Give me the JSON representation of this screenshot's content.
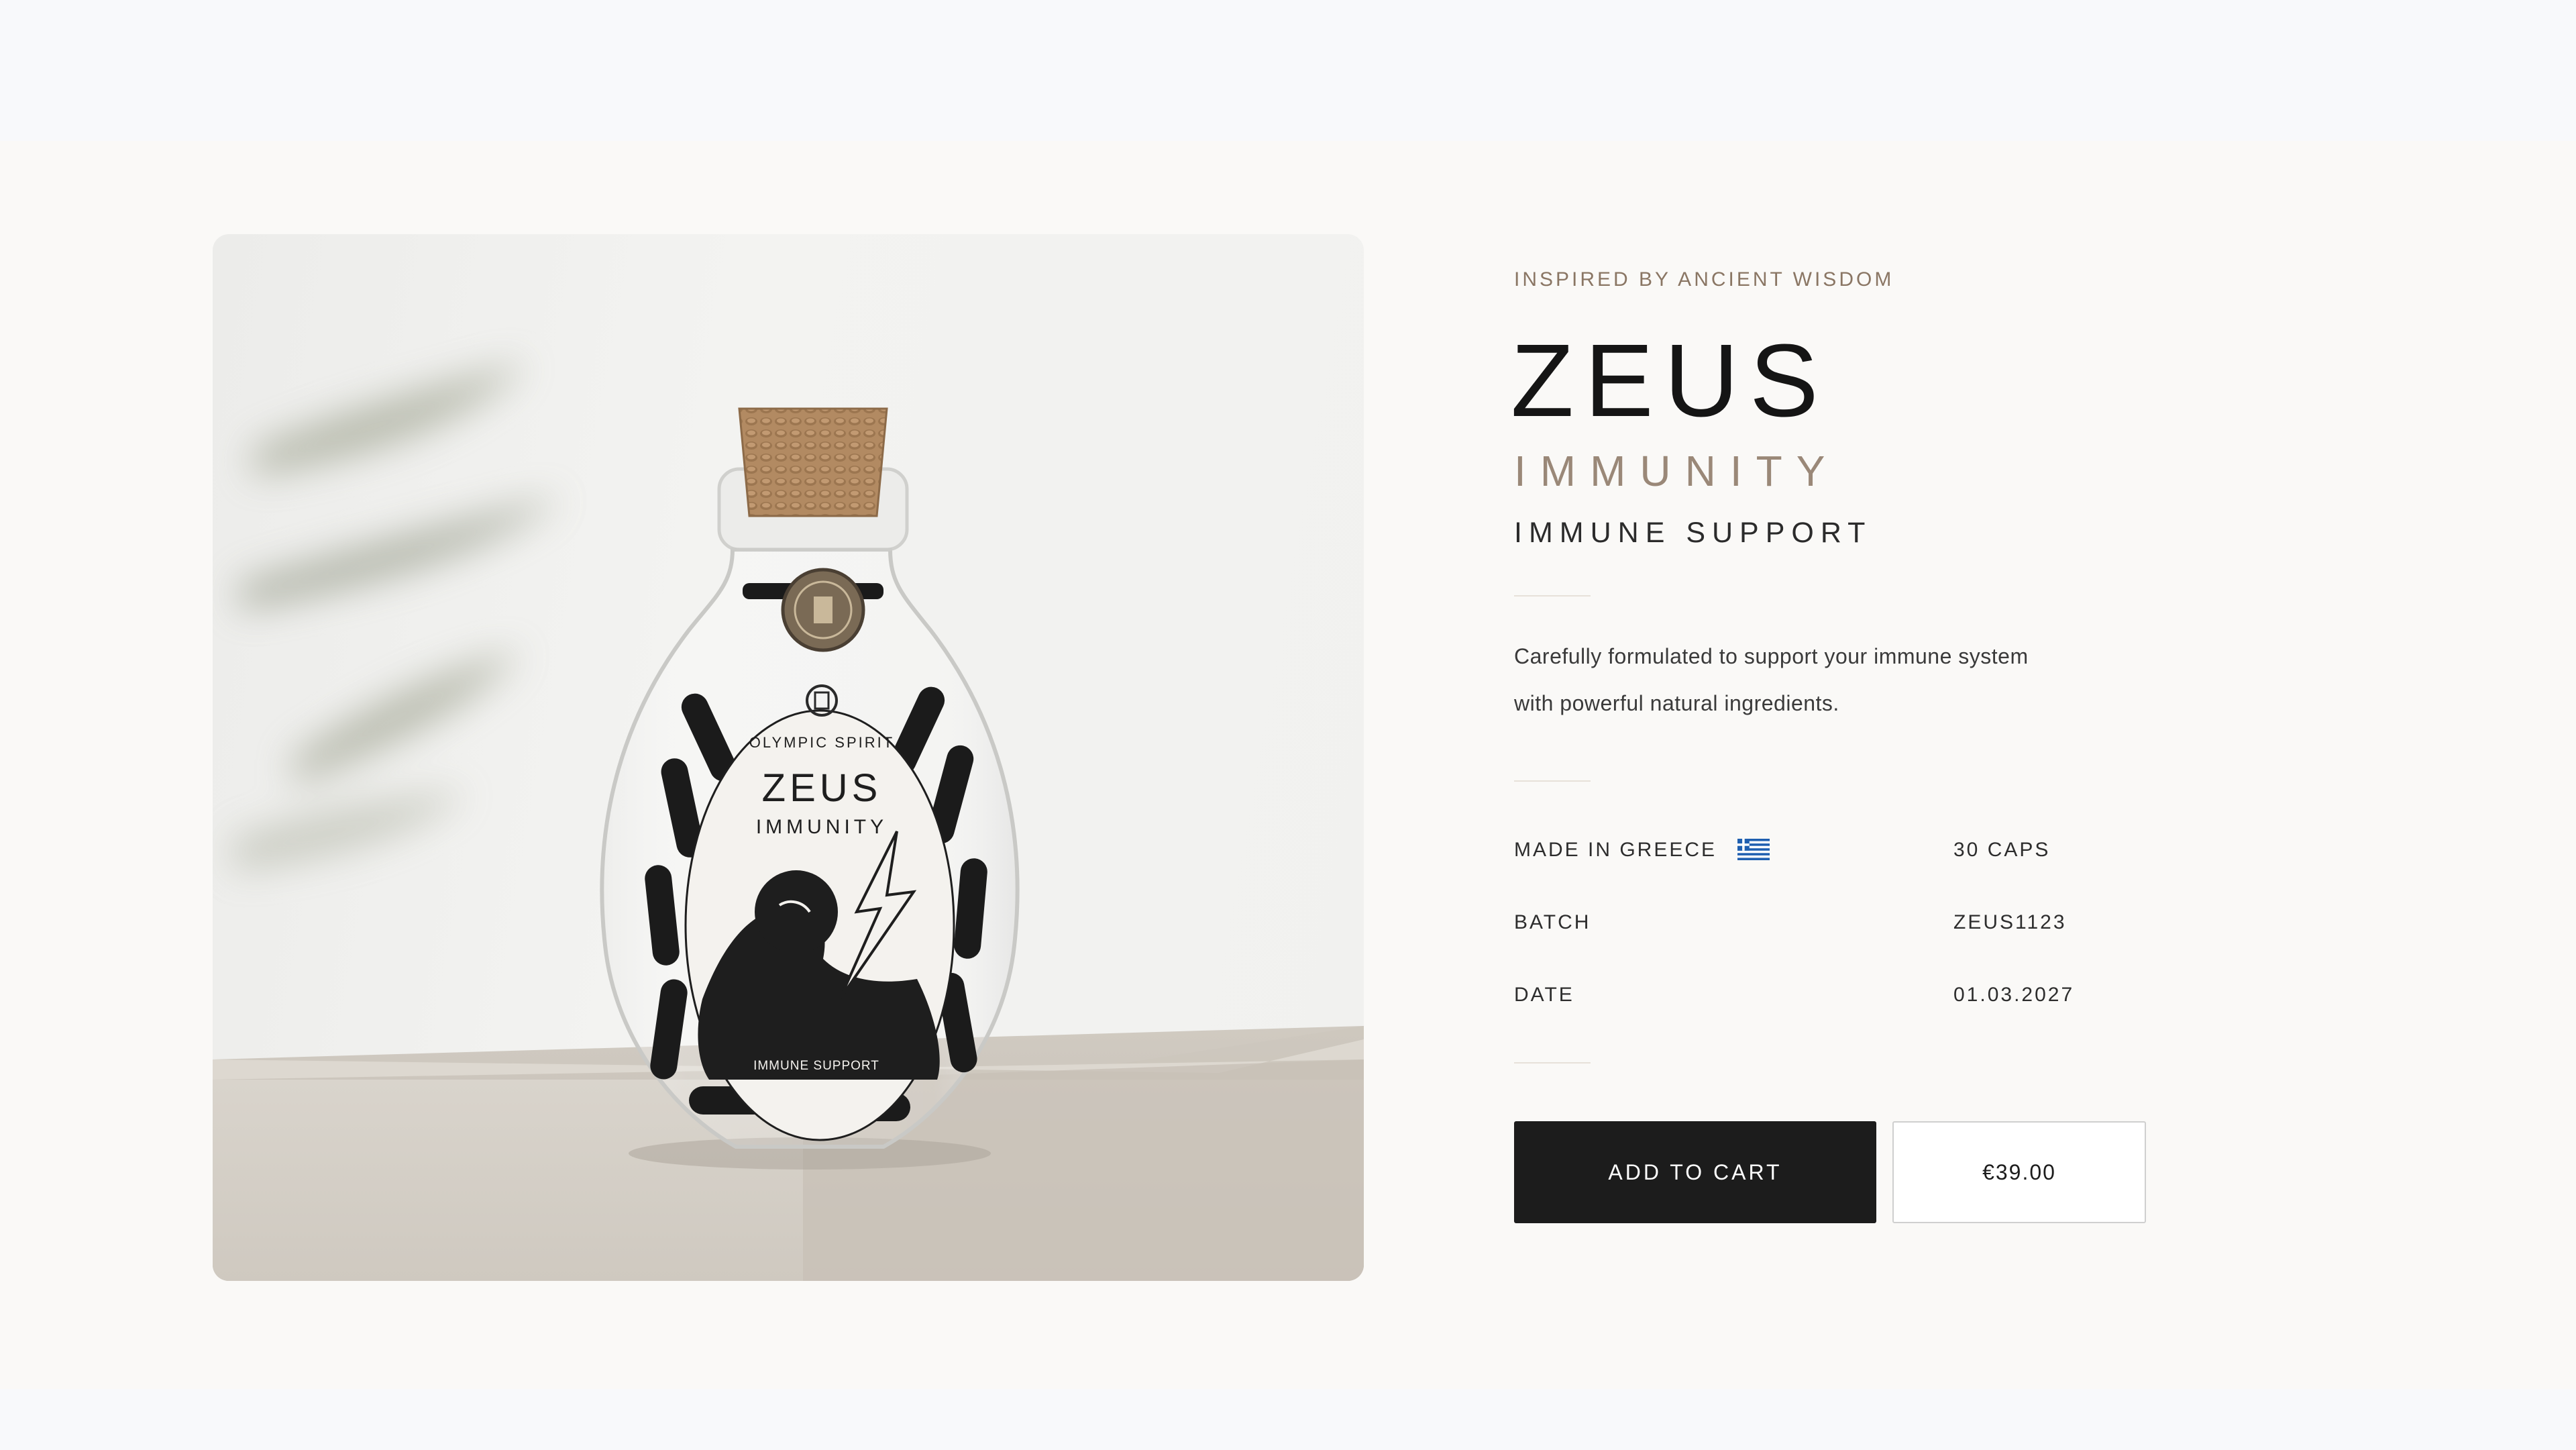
{
  "product": {
    "eyebrow": "INSPIRED BY ANCIENT WISDOM",
    "title": "ZEUS",
    "subtitle": "IMMUNITY",
    "tagline": "IMMUNE SUPPORT",
    "description_lines": [
      "Carefully formulated to support your immune system",
      "with powerful natural ingredients."
    ]
  },
  "specs": [
    {
      "label": "MADE IN GREECE",
      "value": "30 CAPS"
    },
    {
      "label": "BATCH",
      "value": "ZEUS1123"
    },
    {
      "label": "DATE",
      "value": "01.03.2027"
    }
  ],
  "actions": {
    "add_to_cart": "ADD TO CART",
    "price": "€39.00"
  },
  "bottle_label": {
    "brand": "OLYMPIC SPIRIT",
    "name": "ZEUS",
    "variant": "IMMUNITY",
    "footer": "IMMUNE SUPPORT"
  },
  "colors": {
    "accent": "#9a8878",
    "eyebrow": "#8a7664",
    "button_dark": "#1c1c1c",
    "flag_blue": "#1f5fb0"
  },
  "icons": {
    "flag": "greece-flag-icon"
  }
}
